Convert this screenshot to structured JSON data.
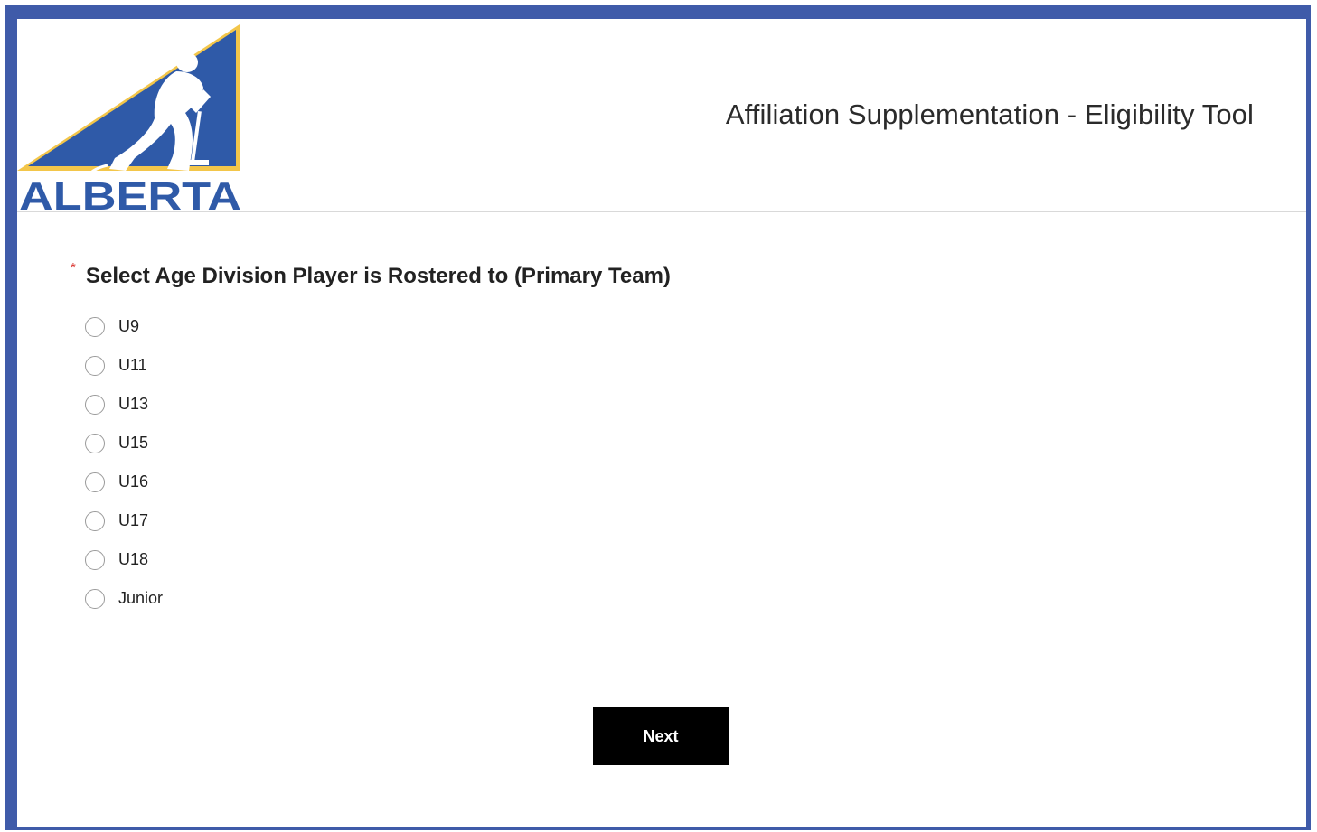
{
  "header": {
    "logo_text": "ALBERTA",
    "title": "Affiliation Supplementation - Eligibility Tool"
  },
  "form": {
    "required_marker": "*",
    "question": "Select Age Division Player is Rostered to (Primary Team)",
    "options": [
      {
        "label": "U9",
        "selected": false
      },
      {
        "label": "U11",
        "selected": false
      },
      {
        "label": "U13",
        "selected": false
      },
      {
        "label": "U15",
        "selected": false
      },
      {
        "label": "U16",
        "selected": false
      },
      {
        "label": "U17",
        "selected": false
      },
      {
        "label": "U18",
        "selected": false
      },
      {
        "label": "Junior",
        "selected": false
      }
    ],
    "next_label": "Next"
  },
  "colors": {
    "frame_border": "#3f5ba9",
    "logo_blue": "#2f5aa8",
    "logo_gold": "#f3c64a",
    "required_star": "#d9302b",
    "button_bg": "#000000",
    "button_text": "#ffffff"
  },
  "icons": {
    "logo": "hockey-alberta-logo",
    "radio": "radio-unchecked"
  }
}
